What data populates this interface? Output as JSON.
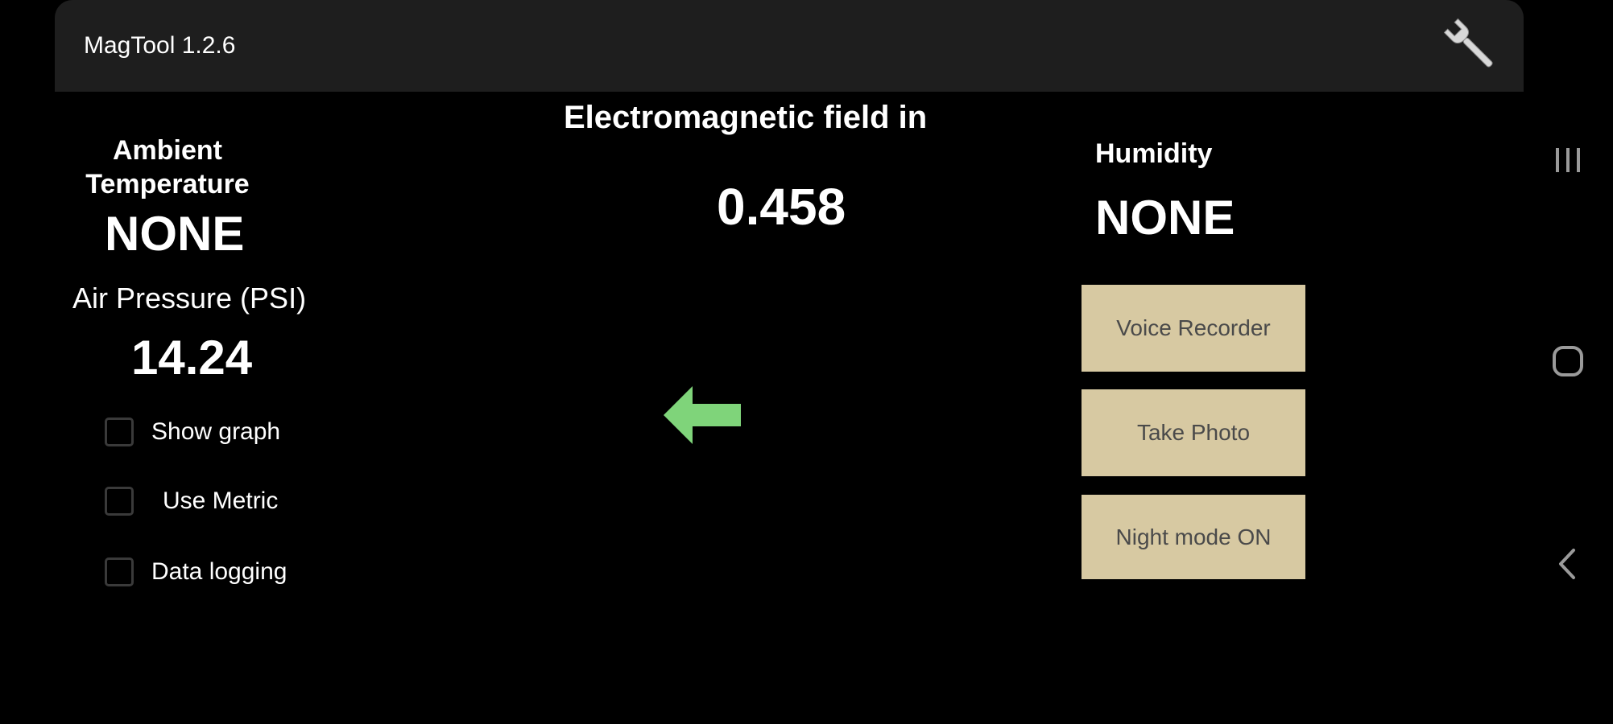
{
  "app": {
    "title": "MagTool 1.2.6",
    "settings_icon": "wrench-icon"
  },
  "sensors": {
    "ambient_temperature": {
      "label": "Ambient Temperature",
      "value": "NONE"
    },
    "air_pressure": {
      "label": "Air Pressure (PSI)",
      "value": "14.24"
    },
    "emf": {
      "label": "Electromagnetic field in",
      "value": "0.458"
    },
    "humidity": {
      "label": "Humidity",
      "value": "NONE"
    }
  },
  "options": [
    {
      "label": "Show graph",
      "checked": false
    },
    {
      "label": "Use Metric",
      "checked": false
    },
    {
      "label": "Data logging",
      "checked": false
    }
  ],
  "direction_indicator": {
    "icon": "left-arrow-icon",
    "color": "#7fd47a"
  },
  "buttons": {
    "voice_recorder": "Voice Recorder",
    "take_photo": "Take Photo",
    "night_mode": "Night mode ON"
  },
  "navigation": {
    "recents_icon": "recents-icon",
    "home_icon": "home-icon",
    "back_icon": "back-icon"
  },
  "colors": {
    "background": "#000000",
    "titlebar": "#1e1e1e",
    "button_bg": "#d7c9a2",
    "button_text": "#4a4a4a"
  }
}
